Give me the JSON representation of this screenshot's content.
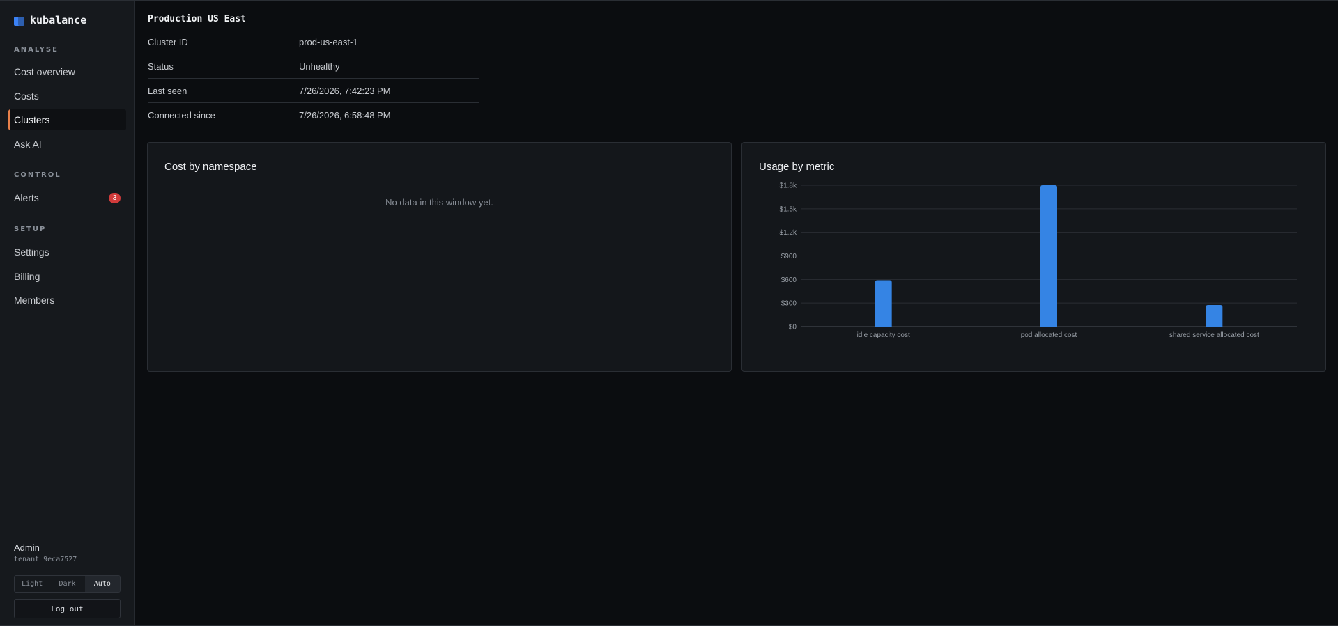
{
  "brand": {
    "name": "kubalance"
  },
  "sidebar": {
    "sections": [
      {
        "label": "ANALYSE",
        "items": [
          {
            "label": "Cost overview",
            "active": false
          },
          {
            "label": "Costs",
            "active": false
          },
          {
            "label": "Clusters",
            "active": true
          },
          {
            "label": "Ask AI",
            "active": false
          }
        ]
      },
      {
        "label": "CONTROL",
        "items": [
          {
            "label": "Alerts",
            "active": false,
            "badge": "3"
          }
        ]
      },
      {
        "label": "SETUP",
        "items": [
          {
            "label": "Settings",
            "active": false
          },
          {
            "label": "Billing",
            "active": false
          },
          {
            "label": "Members",
            "active": false
          }
        ]
      }
    ],
    "user": {
      "name": "Admin",
      "tenant": "tenant 9eca7527"
    },
    "theme": {
      "options": [
        "Light",
        "Dark",
        "Auto"
      ],
      "selected": "Auto"
    },
    "logout_label": "Log out"
  },
  "cluster": {
    "title": "Production US East",
    "details": [
      {
        "key": "Cluster ID",
        "value": "prod-us-east-1"
      },
      {
        "key": "Status",
        "value": "Unhealthy"
      },
      {
        "key": "Last seen",
        "value": "7/26/2026, 7:42:23 PM"
      },
      {
        "key": "Connected since",
        "value": "7/26/2026, 6:58:48 PM"
      }
    ]
  },
  "panels": {
    "namespace": {
      "title": "Cost by namespace",
      "empty": "No data in this window yet."
    },
    "usage": {
      "title": "Usage by metric"
    }
  },
  "chart_data": {
    "type": "bar",
    "categories": [
      "idle capacity cost",
      "pod allocated cost",
      "shared service allocated cost"
    ],
    "values": [
      590,
      1800,
      275
    ],
    "ylim": [
      0,
      1800
    ],
    "yticks": [
      0,
      300,
      600,
      900,
      1200,
      1500,
      1800
    ],
    "ytick_labels": [
      "$0",
      "$300",
      "$600",
      "$900",
      "$1.2k",
      "$1.5k",
      "$1.8k"
    ],
    "bar_color": "#3584e4",
    "grid": true
  },
  "colors": {
    "accent": "#e8804a",
    "badge": "#d13b3b"
  }
}
